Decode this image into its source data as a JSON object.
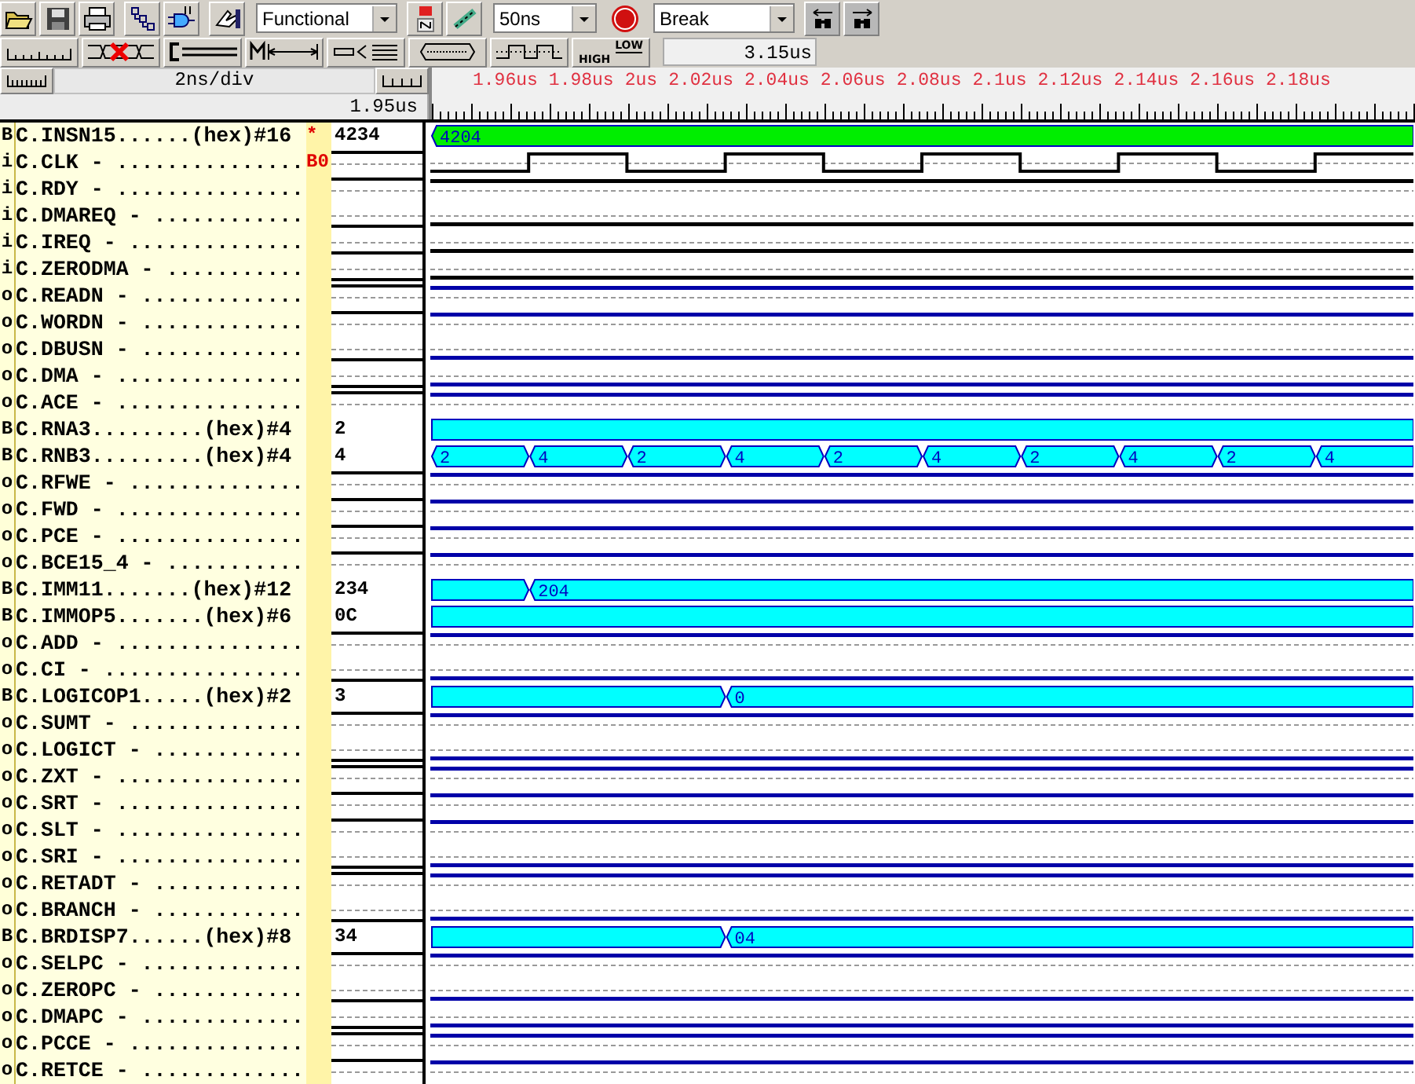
{
  "toolbar": {
    "mode_select": "Functional",
    "step_select": "50ns",
    "break_select": "Break",
    "level_button": {
      "high": "HIGH",
      "low": "LOW"
    },
    "end_time": "3.15us"
  },
  "timebar": {
    "scale": "2ns/div",
    "cursor_time": "1.95us",
    "ruler_labels": [
      "1.96us",
      "1.98us",
      "2us",
      "2.02us",
      "2.04us",
      "2.06us",
      "2.08us",
      "2.1us",
      "2.12us",
      "2.14us",
      "2.16us",
      "2.18us"
    ]
  },
  "signals": [
    {
      "dir": "B",
      "name": "C.INSN15......(hex)#16",
      "marker": "*",
      "kind": "bus",
      "value": "4234",
      "color": "#00ee00",
      "slots": [
        {
          "kind": "start",
          "label": "4204"
        }
      ]
    },
    {
      "dir": "i",
      "name": "C.CLK - ...............",
      "marker": "B0",
      "kind": "clock",
      "high": true,
      "starts_high": false
    },
    {
      "dir": "i",
      "name": "C.RDY - ...............",
      "kind": "bit",
      "high": true
    },
    {
      "dir": "i",
      "name": "C.DMAREQ - ............",
      "kind": "bit",
      "high": false
    },
    {
      "dir": "i",
      "name": "C.IREQ - ..............",
      "kind": "bit",
      "high": false
    },
    {
      "dir": "i",
      "name": "C.ZERODMA - ...........",
      "kind": "bit",
      "high": false
    },
    {
      "dir": "o",
      "name": "C.READN - .............",
      "kind": "bit",
      "high": true
    },
    {
      "dir": "o",
      "name": "C.WORDN - .............",
      "kind": "bit",
      "high": true
    },
    {
      "dir": "o",
      "name": "C.DBUSN - .............",
      "kind": "bit",
      "high": false
    },
    {
      "dir": "o",
      "name": "C.DMA - ...............",
      "kind": "bit",
      "high": false
    },
    {
      "dir": "o",
      "name": "C.ACE - ...............",
      "kind": "bit",
      "high": true
    },
    {
      "dir": "B",
      "name": "C.RNA3.........(hex)#4",
      "kind": "bus",
      "value": "2",
      "color": "#00ffff",
      "slots": [
        {
          "kind": "hold"
        }
      ]
    },
    {
      "dir": "B",
      "name": "C.RNB3.........(hex)#4",
      "kind": "bus",
      "value": "4",
      "color": "#00ffff",
      "slots": [
        {
          "kind": "start",
          "label": "2"
        },
        {
          "kind": "start",
          "label": "4"
        },
        {
          "kind": "start",
          "label": "2"
        },
        {
          "kind": "start",
          "label": "4"
        },
        {
          "kind": "start",
          "label": "2"
        },
        {
          "kind": "start",
          "label": "4"
        },
        {
          "kind": "start",
          "label": "2"
        },
        {
          "kind": "start",
          "label": "4"
        },
        {
          "kind": "start",
          "label": "2"
        },
        {
          "kind": "start",
          "label": "4"
        }
      ]
    },
    {
      "dir": "o",
      "name": "C.RFWE - ..............",
      "kind": "bit",
      "high": true
    },
    {
      "dir": "o",
      "name": "C.FWD - ...............",
      "kind": "bit",
      "high": true
    },
    {
      "dir": "o",
      "name": "C.PCE - ...............",
      "kind": "bit",
      "high": true
    },
    {
      "dir": "o",
      "name": "C.BCE15_4 - ...........",
      "kind": "bit",
      "high": true
    },
    {
      "dir": "B",
      "name": "C.IMM11.......(hex)#12",
      "kind": "bus",
      "value": "234",
      "color": "#00ffff",
      "slots": [
        {
          "kind": "hold"
        },
        {
          "kind": "start",
          "label": "204"
        }
      ]
    },
    {
      "dir": "B",
      "name": "C.IMMOP5.......(hex)#6",
      "kind": "bus",
      "value": "0C",
      "color": "#00ffff",
      "slots": [
        {
          "kind": "hold"
        }
      ]
    },
    {
      "dir": "o",
      "name": "C.ADD - ...............",
      "kind": "bit",
      "high": true
    },
    {
      "dir": "o",
      "name": "C.CI - ................",
      "kind": "bit",
      "high": false
    },
    {
      "dir": "B",
      "name": "C.LOGICOP1.....(hex)#2",
      "kind": "bus",
      "value": "3",
      "color": "#00ffff",
      "slots": [
        {
          "kind": "hold"
        },
        {
          "kind": "hold"
        },
        {
          "kind": "hold"
        },
        {
          "kind": "start",
          "label": "0"
        }
      ]
    },
    {
      "dir": "o",
      "name": "C.SUMT - ..............",
      "kind": "bit",
      "high": true
    },
    {
      "dir": "o",
      "name": "C.LOGICT - ............",
      "kind": "bit",
      "high": false
    },
    {
      "dir": "o",
      "name": "C.ZXT - ...............",
      "kind": "bit",
      "high": true
    },
    {
      "dir": "o",
      "name": "C.SRT - ...............",
      "kind": "bit",
      "high": true
    },
    {
      "dir": "o",
      "name": "C.SLT - ...............",
      "kind": "bit",
      "high": true
    },
    {
      "dir": "o",
      "name": "C.SRI - ...............",
      "kind": "bit",
      "high": false
    },
    {
      "dir": "o",
      "name": "C.RETADT - ............",
      "kind": "bit",
      "high": true
    },
    {
      "dir": "o",
      "name": "C.BRANCH - ............",
      "kind": "bit",
      "high": false
    },
    {
      "dir": "B",
      "name": "C.BRDISP7......(hex)#8",
      "kind": "bus",
      "value": "34",
      "color": "#00ffff",
      "slots": [
        {
          "kind": "hold"
        },
        {
          "kind": "hold"
        },
        {
          "kind": "hold"
        },
        {
          "kind": "start",
          "label": "04"
        }
      ]
    },
    {
      "dir": "o",
      "name": "C.SELPC - .............",
      "kind": "bit",
      "high": true
    },
    {
      "dir": "o",
      "name": "C.ZEROPC - ............",
      "kind": "bit",
      "high": false
    },
    {
      "dir": "o",
      "name": "C.DMAPC - .............",
      "kind": "bit",
      "high": false
    },
    {
      "dir": "o",
      "name": "C.PCCE - ..............",
      "kind": "bit",
      "high": true
    },
    {
      "dir": "o",
      "name": "C.RETCE - .............",
      "kind": "bit",
      "high": true
    }
  ]
}
